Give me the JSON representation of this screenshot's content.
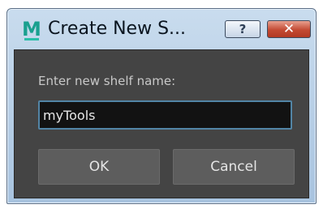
{
  "window": {
    "title": "Create New S...",
    "help_label": "?",
    "close_label": "✕",
    "app_icon_letter": "M"
  },
  "dialog": {
    "prompt": "Enter new shelf name:",
    "shelf_name_value": "myTools",
    "ok_label": "OK",
    "cancel_label": "Cancel"
  },
  "colors": {
    "panel_bg": "#444444",
    "input_border": "#5285a6",
    "button_bg": "#5d5d5d",
    "close_button": "#c34a33",
    "icon_teal": "#1aa08f"
  }
}
